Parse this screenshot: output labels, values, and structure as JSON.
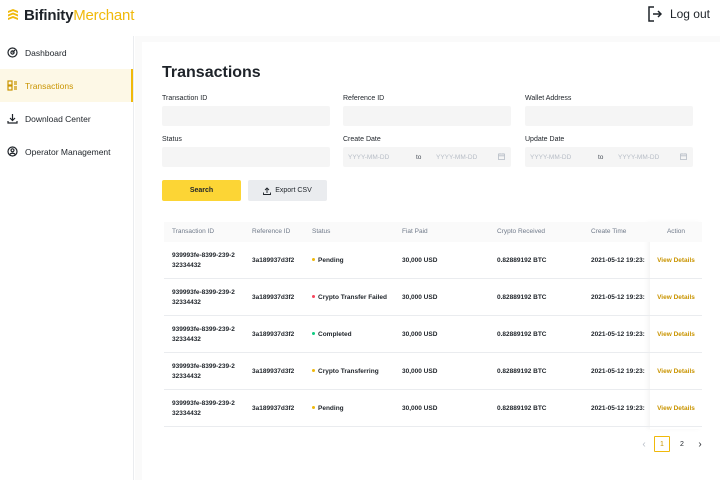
{
  "brand": {
    "name": "Bifinity",
    "accent": "Merchant",
    "accent_color": "#f0b90b"
  },
  "header": {
    "logout_label": "Log out"
  },
  "sidebar": {
    "items": [
      {
        "label": "Dashboard",
        "icon": "dashboard-icon"
      },
      {
        "label": "Transactions",
        "icon": "transactions-icon",
        "active": true
      },
      {
        "label": "Download Center",
        "icon": "download-icon"
      },
      {
        "label": "Operator Management",
        "icon": "operator-icon"
      }
    ]
  },
  "page": {
    "title": "Transactions"
  },
  "filters": {
    "transaction_id_label": "Transaction ID",
    "reference_id_label": "Reference ID",
    "wallet_address_label": "Wallet Address",
    "status_label": "Status",
    "create_date_label": "Create Date",
    "update_date_label": "Update Date",
    "date_placeholder": "YYYY-MM-DD",
    "to_label": "to"
  },
  "actions": {
    "search_label": "Search",
    "export_label": "Export CSV"
  },
  "table": {
    "headers": {
      "transaction_id": "Transaction ID",
      "reference_id": "Reference ID",
      "status": "Status",
      "fiat_paid": "Fiat Paid",
      "crypto_received": "Crypto Received",
      "create_time": "Create Time",
      "action": "Action"
    },
    "rows": [
      {
        "tx_line1": "939993fe-8399-239-2",
        "tx_line2": "32334432",
        "ref": "3a189937d3f2",
        "status": "Pending",
        "status_color": "#f0b90b",
        "fiat": "30,000 USD",
        "crypto": "0.82889192 BTC",
        "time": "2021-05-12 19:23:",
        "action": "View Details"
      },
      {
        "tx_line1": "939993fe-8399-239-2",
        "tx_line2": "32334432",
        "ref": "3a189937d3f2",
        "status": "Crypto Transfer Failed",
        "status_color": "#f6465d",
        "fiat": "30,000 USD",
        "crypto": "0.82889192 BTC",
        "time": "2021-05-12 19:23:",
        "action": "View Details"
      },
      {
        "tx_line1": "939993fe-8399-239-2",
        "tx_line2": "32334432",
        "ref": "3a189937d3f2",
        "status": "Completed",
        "status_color": "#0ecb81",
        "fiat": "30,000 USD",
        "crypto": "0.82889192 BTC",
        "time": "2021-05-12 19:23:",
        "action": "View Details"
      },
      {
        "tx_line1": "939993fe-8399-239-2",
        "tx_line2": "32334432",
        "ref": "3a189937d3f2",
        "status": "Crypto Transferring",
        "status_color": "#f0b90b",
        "fiat": "30,000 USD",
        "crypto": "0.82889192 BTC",
        "time": "2021-05-12 19:23:",
        "action": "View Details"
      },
      {
        "tx_line1": "939993fe-8399-239-2",
        "tx_line2": "32334432",
        "ref": "3a189937d3f2",
        "status": "Pending",
        "status_color": "#f0b90b",
        "fiat": "30,000 USD",
        "crypto": "0.82889192 BTC",
        "time": "2021-05-12 19:23:",
        "action": "View Details"
      }
    ]
  },
  "pagination": {
    "pages": [
      "1",
      "2"
    ],
    "current": "1"
  }
}
